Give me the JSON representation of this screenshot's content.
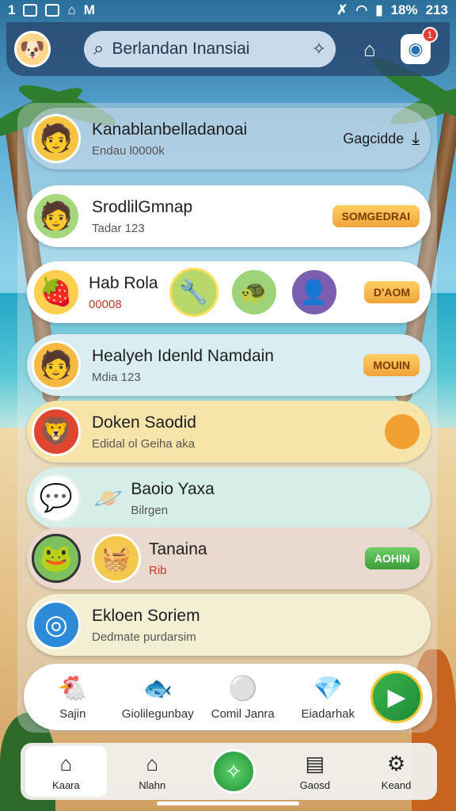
{
  "status_bar": {
    "left_text": "1",
    "battery": "18%",
    "time": "213"
  },
  "header": {
    "search_text": "Berlandan Inansiai",
    "notification_count": "1"
  },
  "cards": [
    {
      "title": "Kanablanbelladanoai",
      "subtitle": "Endau l0000k",
      "action": "Gagcidde"
    },
    {
      "title": "SrodlilGmnap",
      "subtitle": "Tadar 123",
      "action": "SOMGEDRAI"
    },
    {
      "title": "Hab Rola",
      "subtitle": "00008",
      "action": "D'AOM"
    },
    {
      "title": "Healyeh Idenld Namdain",
      "subtitle": "Mdia 123",
      "action": "MOUIN"
    },
    {
      "title": "Doken Saodid",
      "subtitle": "Edidal ol Geiha aka"
    },
    {
      "title": "Baoio Yaxa",
      "subtitle": "Bilrgen"
    },
    {
      "title": "Tanaina",
      "subtitle": "Rib",
      "action": "AOHIN"
    },
    {
      "title": "Ekloen Soriem",
      "subtitle": "Dedmate purdarsim"
    }
  ],
  "quick_bar": [
    {
      "label": "Sajin"
    },
    {
      "label": "Giolilegunbay"
    },
    {
      "label": "Comil Janra"
    },
    {
      "label": "Eiadarhak"
    }
  ],
  "nav": [
    {
      "label": "Kaara"
    },
    {
      "label": "Nlahn"
    },
    {
      "label": "Gaosd"
    },
    {
      "label": "Keand"
    }
  ],
  "colors": {
    "header_bg": "#28466e",
    "card_white": "#ffffff",
    "card_blue": "#d9edf3",
    "card_yellow": "#f7e4a8",
    "card_mint": "#d7eee8",
    "card_peach": "#ead9cf",
    "card_cream": "#f3efd2",
    "pill_orange": "#f0a43a",
    "pill_green": "#4caf50",
    "accent_green": "#1f8f36"
  }
}
